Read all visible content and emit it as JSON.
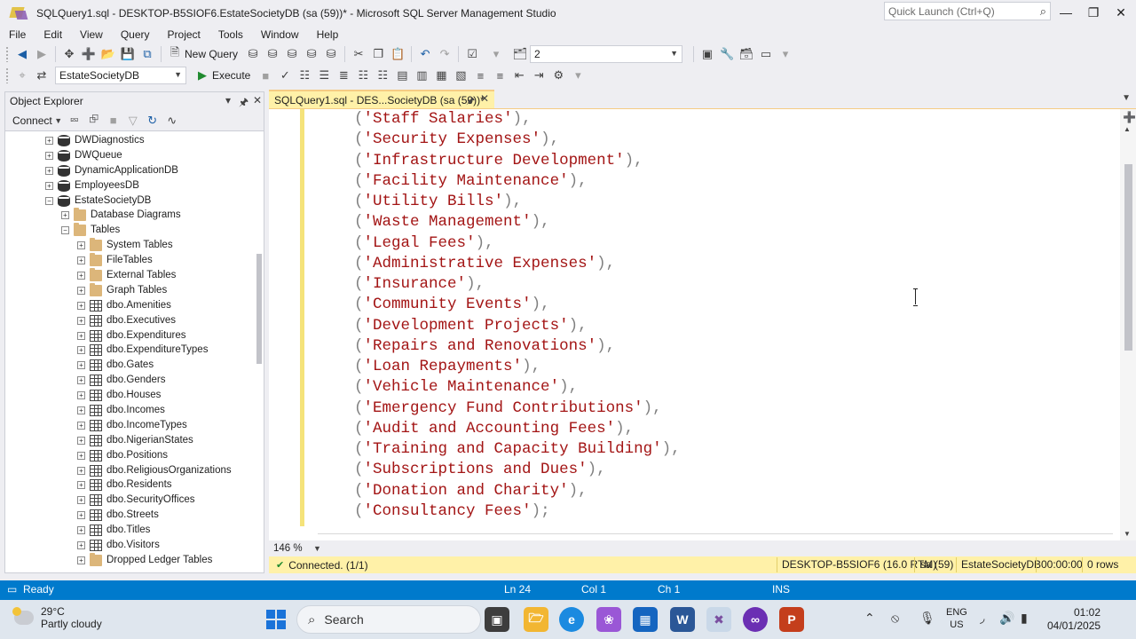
{
  "window": {
    "title": "SQLQuery1.sql - DESKTOP-B5SIOF6.EstateSocietyDB (sa (59))* - Microsoft SQL Server Management Studio",
    "quick_launch_placeholder": "Quick Launch (Ctrl+Q)"
  },
  "menu": [
    "File",
    "Edit",
    "View",
    "Query",
    "Project",
    "Tools",
    "Window",
    "Help"
  ],
  "toolbar": {
    "new_query_label": "New Query",
    "solution_config_value": "2",
    "database_value": "EstateSocietyDB",
    "execute_label": "Execute"
  },
  "object_explorer": {
    "title": "Object Explorer",
    "connect_label": "Connect",
    "tree": [
      {
        "label": "DWDiagnostics",
        "type": "db",
        "level": 0,
        "expander": "+"
      },
      {
        "label": "DWQueue",
        "type": "db",
        "level": 0,
        "expander": "+"
      },
      {
        "label": "DynamicApplicationDB",
        "type": "db",
        "level": 0,
        "expander": "+"
      },
      {
        "label": "EmployeesDB",
        "type": "db",
        "level": 0,
        "expander": "+"
      },
      {
        "label": "EstateSocietyDB",
        "type": "db",
        "level": 0,
        "expander": "−"
      },
      {
        "label": "Database Diagrams",
        "type": "folder",
        "level": 1,
        "expander": "+"
      },
      {
        "label": "Tables",
        "type": "folder",
        "level": 1,
        "expander": "−"
      },
      {
        "label": "System Tables",
        "type": "folder",
        "level": 2,
        "expander": "+"
      },
      {
        "label": "FileTables",
        "type": "folder",
        "level": 2,
        "expander": "+"
      },
      {
        "label": "External Tables",
        "type": "folder",
        "level": 2,
        "expander": "+"
      },
      {
        "label": "Graph Tables",
        "type": "folder",
        "level": 2,
        "expander": "+"
      },
      {
        "label": "dbo.Amenities",
        "type": "table",
        "level": 2,
        "expander": "+"
      },
      {
        "label": "dbo.Executives",
        "type": "table",
        "level": 2,
        "expander": "+"
      },
      {
        "label": "dbo.Expenditures",
        "type": "table",
        "level": 2,
        "expander": "+"
      },
      {
        "label": "dbo.ExpenditureTypes",
        "type": "table",
        "level": 2,
        "expander": "+"
      },
      {
        "label": "dbo.Gates",
        "type": "table",
        "level": 2,
        "expander": "+"
      },
      {
        "label": "dbo.Genders",
        "type": "table",
        "level": 2,
        "expander": "+"
      },
      {
        "label": "dbo.Houses",
        "type": "table",
        "level": 2,
        "expander": "+"
      },
      {
        "label": "dbo.Incomes",
        "type": "table",
        "level": 2,
        "expander": "+"
      },
      {
        "label": "dbo.IncomeTypes",
        "type": "table",
        "level": 2,
        "expander": "+"
      },
      {
        "label": "dbo.NigerianStates",
        "type": "table",
        "level": 2,
        "expander": "+"
      },
      {
        "label": "dbo.Positions",
        "type": "table",
        "level": 2,
        "expander": "+"
      },
      {
        "label": "dbo.ReligiousOrganizations",
        "type": "table",
        "level": 2,
        "expander": "+"
      },
      {
        "label": "dbo.Residents",
        "type": "table",
        "level": 2,
        "expander": "+"
      },
      {
        "label": "dbo.SecurityOffices",
        "type": "table",
        "level": 2,
        "expander": "+"
      },
      {
        "label": "dbo.Streets",
        "type": "table",
        "level": 2,
        "expander": "+"
      },
      {
        "label": "dbo.Titles",
        "type": "table",
        "level": 2,
        "expander": "+"
      },
      {
        "label": "dbo.Visitors",
        "type": "table",
        "level": 2,
        "expander": "+"
      },
      {
        "label": "Dropped Ledger Tables",
        "type": "folder",
        "level": 2,
        "expander": "+"
      }
    ]
  },
  "document_tab": {
    "label": "SQLQuery1.sql - DES...SocietyDB (sa (59))*"
  },
  "editor": {
    "lines": [
      {
        "value": "Staff Salaries",
        "end": "),"
      },
      {
        "value": "Security Expenses",
        "end": "),"
      },
      {
        "value": "Infrastructure Development",
        "end": "),"
      },
      {
        "value": "Facility Maintenance",
        "end": "),"
      },
      {
        "value": "Utility Bills",
        "end": "),"
      },
      {
        "value": "Waste Management",
        "end": "),"
      },
      {
        "value": "Legal Fees",
        "end": "),"
      },
      {
        "value": "Administrative Expenses",
        "end": "),"
      },
      {
        "value": "Insurance",
        "end": "),"
      },
      {
        "value": "Community Events",
        "end": "),"
      },
      {
        "value": "Development Projects",
        "end": "),"
      },
      {
        "value": "Repairs and Renovations",
        "end": "),"
      },
      {
        "value": "Loan Repayments",
        "end": "),"
      },
      {
        "value": "Vehicle Maintenance",
        "end": "),"
      },
      {
        "value": "Emergency Fund Contributions",
        "end": "),"
      },
      {
        "value": "Audit and Accounting Fees",
        "end": "),"
      },
      {
        "value": "Training and Capacity Building",
        "end": "),"
      },
      {
        "value": "Subscriptions and Dues",
        "end": "),"
      },
      {
        "value": "Donation and Charity",
        "end": "),"
      },
      {
        "value": "Consultancy Fees",
        "end": ");"
      }
    ],
    "zoom": "146 %"
  },
  "query_status": {
    "connection": "Connected. (1/1)",
    "server": "DESKTOP-B5SIOF6 (16.0 RTM)",
    "user": "sa (59)",
    "database": "EstateSocietyDB",
    "elapsed": "00:00:00",
    "rows": "0 rows"
  },
  "status_bar": {
    "state": "Ready",
    "line": "Ln 24",
    "col": "Col 1",
    "ch": "Ch 1",
    "mode": "INS"
  },
  "taskbar": {
    "weather_temp": "29°C",
    "weather_desc": "Partly cloudy",
    "search_label": "Search",
    "lang_top": "ENG",
    "lang_bottom": "US",
    "time": "01:02",
    "date": "04/01/2025"
  },
  "colors": {
    "accent": "#007acc",
    "tab_active": "#fff1a8",
    "string": "#a31515"
  }
}
